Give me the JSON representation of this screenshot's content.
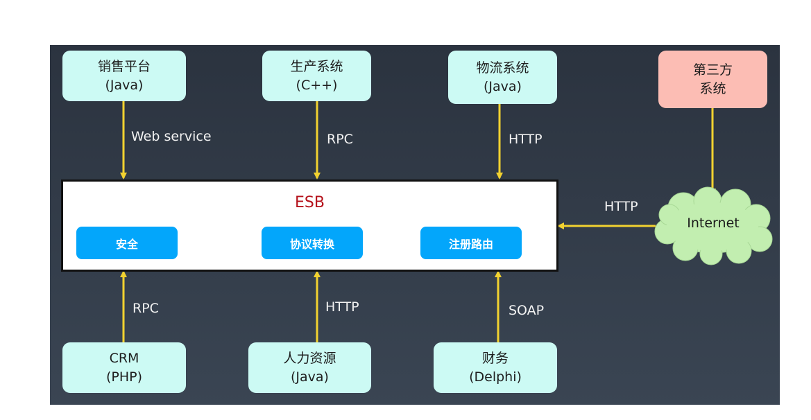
{
  "diagram": {
    "title": "ESB",
    "colors": {
      "background": "#333c48",
      "system_box": "#ccfaf4",
      "third_party_box": "#fcbdb4",
      "arrow": "#f2d230",
      "esb_title": "#b5121b",
      "module": "#03a6fb",
      "cloud": "#c2eeb0"
    },
    "top_systems": [
      {
        "name": "销售平台",
        "tech": "(Java)",
        "protocol": "Web service"
      },
      {
        "name": "生产系统",
        "tech": "(C++)",
        "protocol": "RPC"
      },
      {
        "name": "物流系统",
        "tech": "(Java)",
        "protocol": "HTTP"
      }
    ],
    "third_party": {
      "line1": "第三方",
      "line2": "系统"
    },
    "cloud": {
      "label": "Internet",
      "protocol": "HTTP"
    },
    "esb_modules": [
      "安全",
      "协议转换",
      "注册路由"
    ],
    "bottom_systems": [
      {
        "name": "CRM",
        "tech": "(PHP)",
        "protocol": "RPC"
      },
      {
        "name": "人力资源",
        "tech": "(Java)",
        "protocol": "HTTP"
      },
      {
        "name": "财务",
        "tech": "(Delphi)",
        "protocol": "SOAP"
      }
    ]
  }
}
